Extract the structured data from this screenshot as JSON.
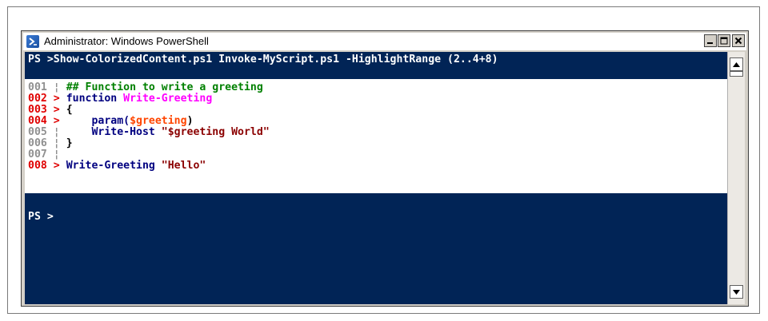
{
  "window": {
    "title": "Administrator: Windows PowerShell"
  },
  "console": {
    "command_line": "PS >Show-ColorizedContent.ps1 Invoke-MyScript.ps1 -HighlightRange (2..4+8)",
    "code_lines": [
      {
        "num": "001",
        "highlighted": false,
        "marker": "¦",
        "tokens": [
          {
            "t": "## Function to write a greeting",
            "c": "c-comment"
          }
        ]
      },
      {
        "num": "002",
        "highlighted": true,
        "marker": ">",
        "tokens": [
          {
            "t": "function ",
            "c": "c-keyword"
          },
          {
            "t": "Write-Greeting",
            "c": "c-func"
          }
        ]
      },
      {
        "num": "003",
        "highlighted": true,
        "marker": ">",
        "tokens": [
          {
            "t": "{",
            "c": "c-plain"
          }
        ]
      },
      {
        "num": "004",
        "highlighted": true,
        "marker": ">",
        "tokens": [
          {
            "t": "    param(",
            "c": "c-keyword"
          },
          {
            "t": "$greeting",
            "c": "c-var"
          },
          {
            "t": ")",
            "c": "c-plain"
          }
        ]
      },
      {
        "num": "005",
        "highlighted": false,
        "marker": "¦",
        "tokens": [
          {
            "t": "    Write-Host ",
            "c": "c-cmd"
          },
          {
            "t": "\"$greeting World\"",
            "c": "c-str"
          }
        ]
      },
      {
        "num": "006",
        "highlighted": false,
        "marker": "¦",
        "tokens": [
          {
            "t": "}",
            "c": "c-plain"
          }
        ]
      },
      {
        "num": "007",
        "highlighted": false,
        "marker": "¦",
        "tokens": []
      },
      {
        "num": "008",
        "highlighted": true,
        "marker": ">",
        "tokens": [
          {
            "t": "Write-Greeting ",
            "c": "c-cmd"
          },
          {
            "t": "\"Hello\"",
            "c": "c-str"
          }
        ]
      }
    ],
    "prompt": "PS >"
  },
  "colors": {
    "console_bg": "#012456",
    "highlight_bg": "#ffffff",
    "line_number_highlight": "#e00000",
    "comment": "#008000",
    "function_name": "#ff00ff",
    "variable": "#ff4500",
    "string": "#8b0000",
    "keyword": "#000080"
  },
  "icons": {
    "app": "powershell-icon",
    "minimize": "minimize-icon",
    "maximize": "maximize-icon",
    "close": "close-icon",
    "scroll_up": "arrow-up-icon",
    "scroll_down": "arrow-down-icon"
  }
}
